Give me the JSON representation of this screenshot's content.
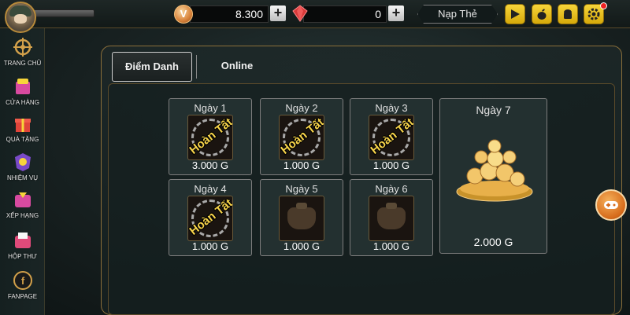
{
  "topbar": {
    "coin_symbol": "V",
    "coin_amount": "8.300",
    "gem_amount": "0",
    "plus_label": "+",
    "nap_the": "Nạp Thẻ",
    "icons": [
      "play-store-icon",
      "apple-icon",
      "android-icon",
      "settings-gear-icon"
    ]
  },
  "sidebar": {
    "items": [
      {
        "label": "TRANG CHỦ",
        "icon": "ship-wheel-icon"
      },
      {
        "label": "CỬA HÀNG",
        "icon": "shop-icon"
      },
      {
        "label": "QUÀ TẶNG",
        "icon": "gift-icon"
      },
      {
        "label": "NHIỆM VỤ",
        "icon": "mission-icon"
      },
      {
        "label": "XẾP HẠNG",
        "icon": "ranking-icon"
      },
      {
        "label": "HỘP THƯ",
        "icon": "mailbox-icon"
      },
      {
        "label": "FANPAGE",
        "icon": "fanpage-icon"
      }
    ]
  },
  "tabs": {
    "active": "Điểm Danh",
    "inactive": "Online"
  },
  "days": [
    {
      "label": "Ngày 1",
      "reward": "3.000 G",
      "status": "Hoàn Tất"
    },
    {
      "label": "Ngày 2",
      "reward": "1.000 G",
      "status": "Hoàn Tất"
    },
    {
      "label": "Ngày 3",
      "reward": "1.000 G",
      "status": "Hoàn Tất"
    },
    {
      "label": "Ngày 4",
      "reward": "1.000 G",
      "status": "Hoàn Tất"
    },
    {
      "label": "Ngày 5",
      "reward": "1.000 G",
      "status": ""
    },
    {
      "label": "Ngày 6",
      "reward": "1.000 G",
      "status": ""
    },
    {
      "label": "Ngày 7",
      "reward": "2.000 G",
      "status": ""
    }
  ],
  "colors": {
    "accent_gold": "#f6d34a",
    "panel_border": "#8b6f3a",
    "card_bg": "#233030",
    "topbar_icon_yellow": "#f7d53a"
  }
}
